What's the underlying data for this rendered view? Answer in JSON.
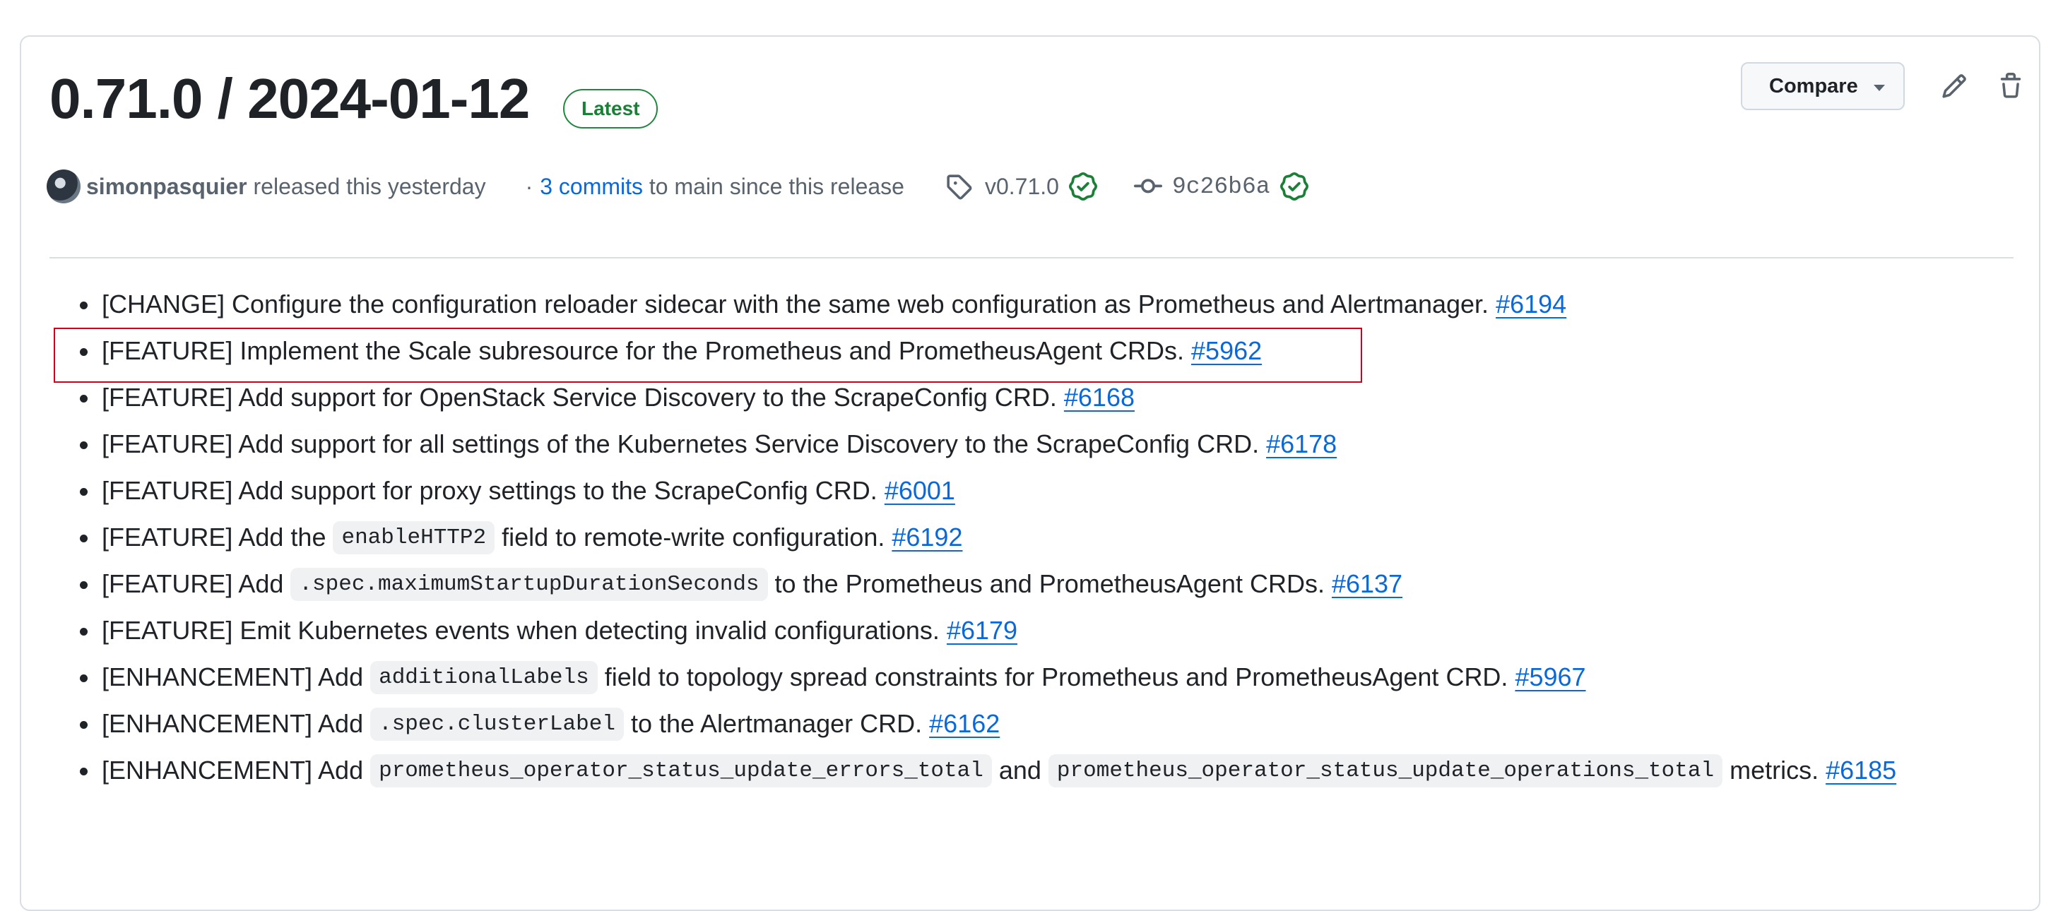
{
  "release": {
    "title": "0.71.0 / 2024-01-12",
    "badge": "Latest",
    "compare_label": "Compare",
    "author": "simonpasquier",
    "released_text": " released this yesterday",
    "separator": "·",
    "commits_link": "3 commits",
    "commits_suffix": " to main since this release",
    "tag": "v0.71.0",
    "commit_hash": "9c26b6a",
    "icons": [
      "edit-pencil-icon",
      "trash-icon",
      "tag-icon",
      "commit-icon",
      "verified-check-icon"
    ],
    "colors": {
      "link": "#0969da",
      "badge": "#1a7f37",
      "highlight_box": "#d0021b"
    }
  },
  "notes": [
    {
      "prefix": "[CHANGE] Configure the configuration reloader sidecar with the same web configuration as Prometheus and Alertmanager.",
      "pr": "#6194"
    },
    {
      "prefix": "[FEATURE] Implement the Scale subresource for the Prometheus and PrometheusAgent CRDs.",
      "pr": "#5962"
    },
    {
      "prefix": "[FEATURE] Add support for OpenStack Service Discovery to the ScrapeConfig CRD.",
      "pr": "#6168"
    },
    {
      "prefix": "[FEATURE] Add support for all settings of the Kubernetes Service Discovery to the ScrapeConfig CRD.",
      "pr": "#6178"
    },
    {
      "prefix": "[FEATURE] Add support for proxy settings to the ScrapeConfig CRD.",
      "pr": "#6001"
    },
    {
      "prefix": "[FEATURE] Add the",
      "code": "enableHTTP2",
      "suffix": "field to remote-write configuration.",
      "pr": "#6192"
    },
    {
      "prefix": "[FEATURE] Add",
      "code": ".spec.maximumStartupDurationSeconds",
      "suffix": "to the Prometheus and PrometheusAgent CRDs.",
      "pr": "#6137"
    },
    {
      "prefix": "[FEATURE] Emit Kubernetes events when detecting invalid configurations.",
      "pr": "#6179"
    },
    {
      "prefix": "[ENHANCEMENT] Add",
      "code": "additionalLabels",
      "suffix": "field to topology spread constraints for Prometheus and PrometheusAgent CRD.",
      "pr": "#5967"
    },
    {
      "prefix": "[ENHANCEMENT] Add",
      "code": ".spec.clusterLabel",
      "suffix": "to the Alertmanager CRD.",
      "pr": "#6162"
    },
    {
      "prefix": "[ENHANCEMENT] Add",
      "code": "prometheus_operator_status_update_errors_total",
      "middle": "and",
      "code2": "prometheus_operator_status_update_operations_total",
      "suffix": "metrics.",
      "pr": "#6185"
    }
  ]
}
